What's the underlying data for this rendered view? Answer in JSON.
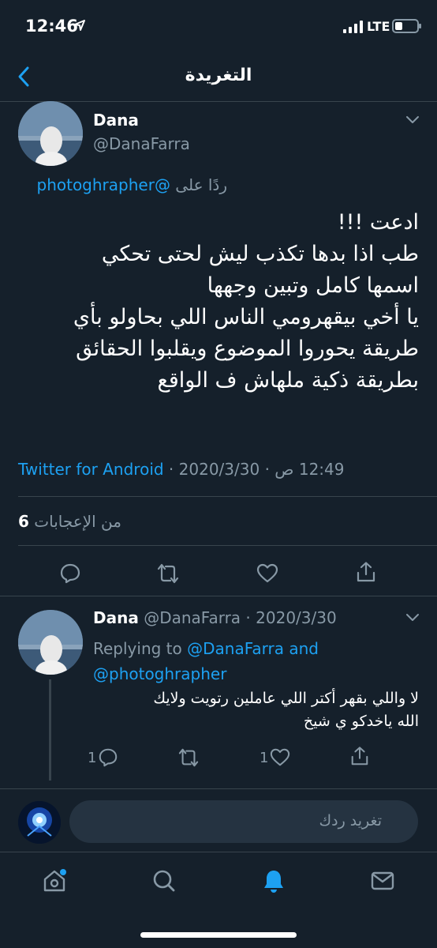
{
  "status_bar": {
    "time": "12:46",
    "network": "LTE"
  },
  "header": {
    "title": "التغريدة"
  },
  "main_tweet": {
    "author_name": "Dana",
    "author_handle": "@DanaFarra",
    "replying_prefix": "ردًا على",
    "replying_mention": "@photoghrapher",
    "text": "ادعت !!!\nطب اذا بدها تكذب ليش لحتى تحكي\nاسمها كامل وتبين وجهها\nيا أخي بيقهرومي الناس اللي بحاولو بأي\nطريقة يحوروا الموضوع ويقلبوا الحقائق\nبطريقة ذكية ملهاش ف الواقع",
    "time": "12:49 ص",
    "date": "2020/3/30",
    "source": "Twitter for Android",
    "likes_count": "6",
    "likes_label": "من الإعجابات"
  },
  "reply_tweet": {
    "author_name": "Dana",
    "author_handle": "@DanaFarra",
    "date": "2020/3/30",
    "replying_label": "Replying to",
    "mention_1": "@DanaFarra",
    "and": "and",
    "mention_2": "@photoghrapher",
    "text": "لا واللي بقهر أكتر اللي عاملين رتويت ولايك\nالله ياخدكو ي شيخ",
    "reply_count": "1",
    "like_count": "1"
  },
  "compose": {
    "placeholder": "تغريد ردك"
  },
  "tabs": [
    "home-icon",
    "search-icon",
    "notifications-icon",
    "messages-icon"
  ],
  "colors": {
    "background": "#15202b",
    "accent": "#1da1f2",
    "secondary_text": "#8899a6",
    "border": "#38444d"
  }
}
